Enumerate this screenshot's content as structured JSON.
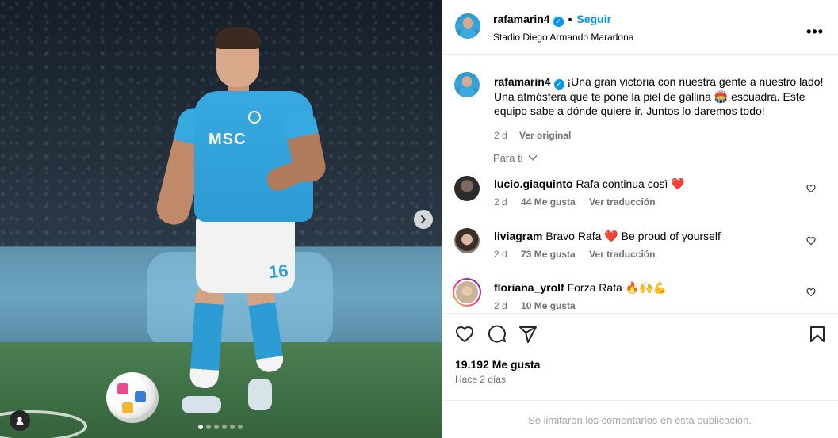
{
  "post": {
    "username": "rafamarin4",
    "verified_mark": "✓",
    "follow_label": "Seguir",
    "separator": "•",
    "location": "Stadio Diego Armando Maradona",
    "more_label": "•••"
  },
  "media": {
    "sponsor_text": "MSC",
    "shirt_number": "16",
    "slide_count": 6,
    "active_slide": 1,
    "next_icon": "chevron-right-icon",
    "user_tag_icon": "person-icon"
  },
  "caption": {
    "username": "rafamarin4",
    "text": "¡Una gran victoria con nuestra gente a nuestro lado! Una atmósfera que te pone la piel de gallina 🏟️ escuadra. Este equipo sabe a dónde quiere ir. Juntos lo daremos todo!",
    "time": "2 d",
    "see_original": "Ver original"
  },
  "for_you_label": "Para ti",
  "comments": [
    {
      "username": "lucio.giaquinto",
      "text": "Rafa continua così",
      "emoji": "❤️",
      "time": "2 d",
      "likes": "44 Me gusta",
      "translate": "Ver traducción",
      "avatar_color": "#2b2b2b"
    },
    {
      "username": "liviagram",
      "text": "Bravo Rafa",
      "emoji": "❤️",
      "text2": "Be proud of yourself",
      "time": "2 d",
      "likes": "73 Me gusta",
      "translate": "Ver traducción",
      "avatar_color": "#6b5a4e"
    },
    {
      "username": "floriana_yrolf",
      "text": "Forza Rafa",
      "emoji": "🔥🙌💪",
      "time": "2 d",
      "likes": "10 Me gusta",
      "avatar_color": "#c9b49a"
    }
  ],
  "actions": {
    "like_icon": "heart-icon",
    "comment_icon": "comment-icon",
    "share_icon": "send-icon",
    "save_icon": "bookmark-icon"
  },
  "likes_count": "19.192 Me gusta",
  "posted_ago": "Hace 2 días",
  "comments_limited": "Se limitaron los comentarios en esta publicación.",
  "colors": {
    "accent": "#0095f6",
    "muted": "#737373",
    "divider": "#efefef",
    "napoli_blue": "#2d9bd4"
  }
}
